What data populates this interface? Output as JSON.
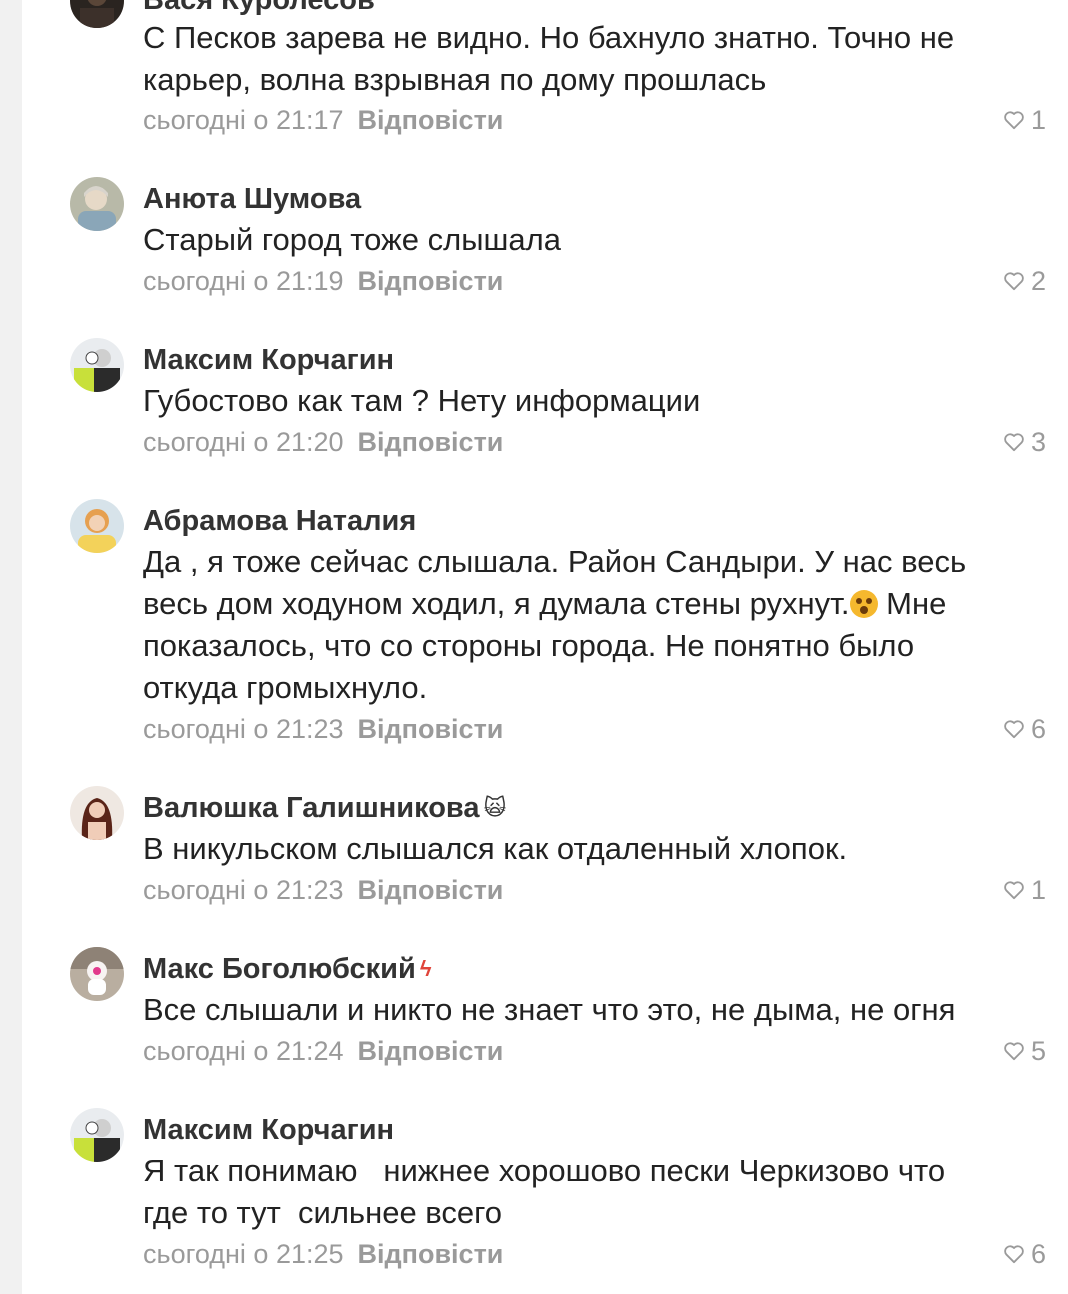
{
  "reply_label": "Відповісти",
  "comments": [
    {
      "author": "Вася Куролесов",
      "text_lines": [
        "С Песков зарева не видно. Но бахнуло знатно. Точно не",
        "карьер, волна взрывная по дому прошлась"
      ],
      "time": "сьогодні о 21:17",
      "likes": "1",
      "avatar": "dark-photo-avatar"
    },
    {
      "author": "Анюта Шумова",
      "text_lines": [
        "Старый город тоже слышала"
      ],
      "time": "сьогодні о 21:19",
      "likes": "2",
      "avatar": "elderly-woman-photo-avatar"
    },
    {
      "author": "Максим Корчагин",
      "text_lines": [
        "Губостово как там ? Нету информации"
      ],
      "time": "сьогодні о 21:20",
      "likes": "3",
      "avatar": "man-green-vest-photo-avatar"
    },
    {
      "author": "Абрамова Наталия",
      "text_lines": [
        "Да , я тоже сейчас слышала. Район Сандыри.  У нас весь",
        "весь дом ходуном ходил, я думала стены рухнут.",
        "показалось, что со стороны города. Не понятно было",
        "откуда громыхнуло."
      ],
      "line2_suffix": " Мне",
      "time": "сьогодні о 21:23",
      "likes": "6",
      "avatar": "woman-orange-hair-photo-avatar"
    },
    {
      "author": "Валюшка Галишникова",
      "text_lines": [
        "В никульском слышался как отдаленный хлопок."
      ],
      "time": "сьогодні о 21:23",
      "likes": "1",
      "avatar": "woman-dark-hair-photo-avatar"
    },
    {
      "author": "Макс Боголюбский",
      "text_lines": [
        "Все слышали и никто не знает что это, не дыма, не огня"
      ],
      "time": "сьогодні о 21:24",
      "likes": "5",
      "avatar": "pink-toy-photo-avatar"
    },
    {
      "author": "Максим Корчагин",
      "text_lines": [
        "Я так понимаю   нижнее хорошово пески Черкизово что",
        "где то тут  сильнее всего"
      ],
      "time": "сьогодні о 21:25",
      "likes": "6",
      "avatar": "man-green-vest-photo-avatar"
    }
  ],
  "colors": {
    "text": "#222222",
    "author": "#333333",
    "meta": "#9a9a9a",
    "background": "#ffffff"
  }
}
